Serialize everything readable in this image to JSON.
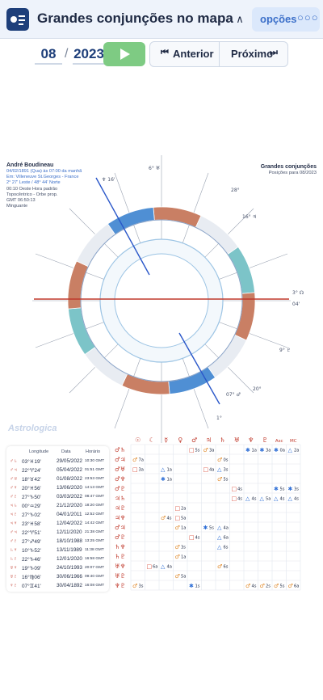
{
  "header": {
    "title": "Grandes conjunções no mapa",
    "options_label": "opções",
    "options_dots": "○○○",
    "collapse_glyph": "∧"
  },
  "date_nav": {
    "month": "08",
    "separator": "/",
    "year": "2023",
    "prev_label": "Anterior",
    "next_label": "Próximo"
  },
  "chart": {
    "left_info": {
      "name": "André Boudineau",
      "line1": "04/02/1891 (Qua) às 07:00 da manhã",
      "line2": "Em: Villeneuve St.Georges - France",
      "line3": "2° 27' Leste / 48° 44' Norte",
      "line4": "00:10 Oeste Hora padrão",
      "line5": "Topocêntrico - Orbe prop.",
      "line6": "GMT 06:50:13",
      "line7": "Minguante"
    },
    "right_info": {
      "name": "Grandes conjunções",
      "line1": "Posições para 08/2023"
    },
    "watermark": "Astrologica",
    "outer_labels": [
      {
        "text": "16'",
        "glyph": "♆"
      },
      {
        "text": "6°",
        "glyph": "♅"
      },
      {
        "text": "28°",
        "glyph": ""
      },
      {
        "text": "16°",
        "glyph": "♃"
      },
      {
        "text": "3°",
        "glyph": "☊"
      },
      {
        "text": "04'",
        "glyph": ""
      },
      {
        "text": "9°",
        "glyph": "♇"
      },
      {
        "text": "20°",
        "glyph": ""
      },
      {
        "text": "07°",
        "glyph": "♂"
      },
      {
        "text": "1°",
        "glyph": ""
      }
    ]
  },
  "left_table": {
    "headers": [
      "Longitude",
      "Data",
      "Horário"
    ],
    "rows": [
      {
        "pair": "♂♄",
        "lon": "03°♓19'",
        "date": "29/05/2022",
        "time": "10:30 GMT"
      },
      {
        "pair": "♂♃",
        "lon": "22°♈24'",
        "date": "05/04/2022",
        "time": "01:51 GMT"
      },
      {
        "pair": "♂♅",
        "lon": "18°♉42'",
        "date": "01/08/2022",
        "time": "23:53 GMT"
      },
      {
        "pair": "♂♆",
        "lon": "20°♓56'",
        "date": "13/06/2020",
        "time": "14:13 GMT"
      },
      {
        "pair": "♂♇",
        "lon": "27°♑50'",
        "date": "03/03/2022",
        "time": "08:47 GMT"
      },
      {
        "pair": "♃♄",
        "lon": "00°♒29'",
        "date": "21/12/2020",
        "time": "18:20 GMT"
      },
      {
        "pair": "♃♇",
        "lon": "27°♑02'",
        "date": "04/01/2011",
        "time": "12:52 GMT"
      },
      {
        "pair": "♃♆",
        "lon": "23°♓58'",
        "date": "12/04/2022",
        "time": "14:42 GMT"
      },
      {
        "pair": "♂♃",
        "lon": "22°♈51'",
        "date": "12/11/2020",
        "time": "21:38 GMT"
      },
      {
        "pair": "♂♇",
        "lon": "27°♐49'",
        "date": "18/10/1988",
        "time": "13:25 GMT"
      },
      {
        "pair": "♄♆",
        "lon": "10°♑52'",
        "date": "13/11/1989",
        "time": "11:38 GMT"
      },
      {
        "pair": "♄♇",
        "lon": "22°♑46'",
        "date": "12/01/2020",
        "time": "16:58 GMT"
      },
      {
        "pair": "♅♆",
        "lon": "19°♑09'",
        "date": "24/10/1993",
        "time": "20:07 GMT"
      },
      {
        "pair": "♅♇",
        "lon": "16°♍06'",
        "date": "30/06/1966",
        "time": "09:40 GMT"
      },
      {
        "pair": "♆♇",
        "lon": "07°♊41'",
        "date": "30/04/1892",
        "time": "16:08 GMT"
      }
    ]
  },
  "aspect_grid": {
    "col_glyphs": [
      "☉",
      "☾",
      "☿",
      "♀",
      "♂",
      "♃",
      "♄",
      "♅",
      "♆",
      "♇",
      "Asc",
      "MC"
    ],
    "row_glyphs": [
      "♂♄",
      "♂♃",
      "♂♅",
      "♂♆",
      "♂♇",
      "♃♄",
      "♃♇",
      "♃♆",
      "♂♃",
      "♂♇",
      "♄♆",
      "♄♇",
      "♅♆",
      "♅♇",
      "♆♇"
    ],
    "cells": [
      {
        "r": 0,
        "c": 4,
        "sym": "□",
        "val": "5s",
        "color": "#d84b3a"
      },
      {
        "r": 0,
        "c": 5,
        "sym": "♂",
        "val": "3a",
        "color": "#e08a2c"
      },
      {
        "r": 0,
        "c": 8,
        "sym": "✱",
        "val": "1a",
        "color": "#2f6fd6"
      },
      {
        "r": 0,
        "c": 9,
        "sym": "✱",
        "val": "3a",
        "color": "#2f6fd6"
      },
      {
        "r": 0,
        "c": 10,
        "sym": "✱",
        "val": "0a",
        "color": "#2f6fd6"
      },
      {
        "r": 0,
        "c": 11,
        "sym": "△",
        "val": "2a",
        "color": "#2f6fd6"
      },
      {
        "r": 1,
        "c": 0,
        "sym": "♂",
        "val": "7a",
        "color": "#e08a2c"
      },
      {
        "r": 1,
        "c": 6,
        "sym": "♂",
        "val": "0s",
        "color": "#e08a2c"
      },
      {
        "r": 2,
        "c": 0,
        "sym": "□",
        "val": "3a",
        "color": "#d84b3a"
      },
      {
        "r": 2,
        "c": 2,
        "sym": "△",
        "val": "1a",
        "color": "#2f6fd6"
      },
      {
        "r": 2,
        "c": 5,
        "sym": "□",
        "val": "4a",
        "color": "#d84b3a"
      },
      {
        "r": 2,
        "c": 6,
        "sym": "△",
        "val": "3s",
        "color": "#2f6fd6"
      },
      {
        "r": 3,
        "c": 2,
        "sym": "✱",
        "val": "1a",
        "color": "#2f6fd6"
      },
      {
        "r": 3,
        "c": 6,
        "sym": "♂",
        "val": "5s",
        "color": "#e08a2c"
      },
      {
        "r": 4,
        "c": 7,
        "sym": "□",
        "val": "4s",
        "color": "#d84b3a"
      },
      {
        "r": 4,
        "c": 10,
        "sym": "✱",
        "val": "5s",
        "color": "#2f6fd6"
      },
      {
        "r": 4,
        "c": 11,
        "sym": "✱",
        "val": "3s",
        "color": "#2f6fd6"
      },
      {
        "r": 5,
        "c": 7,
        "sym": "□",
        "val": "4s",
        "color": "#d84b3a"
      },
      {
        "r": 5,
        "c": 8,
        "sym": "△",
        "val": "4s",
        "color": "#2f6fd6"
      },
      {
        "r": 5,
        "c": 9,
        "sym": "△",
        "val": "5a",
        "color": "#2f6fd6"
      },
      {
        "r": 5,
        "c": 10,
        "sym": "△",
        "val": "4s",
        "color": "#2f6fd6"
      },
      {
        "r": 5,
        "c": 11,
        "sym": "△",
        "val": "4s",
        "color": "#2f6fd6"
      },
      {
        "r": 6,
        "c": 3,
        "sym": "□",
        "val": "2a",
        "color": "#d84b3a"
      },
      {
        "r": 7,
        "c": 2,
        "sym": "♂",
        "val": "4s",
        "color": "#e08a2c"
      },
      {
        "r": 7,
        "c": 3,
        "sym": "□",
        "val": "5a",
        "color": "#d84b3a"
      },
      {
        "r": 8,
        "c": 3,
        "sym": "♂",
        "val": "1a",
        "color": "#e08a2c"
      },
      {
        "r": 8,
        "c": 5,
        "sym": "✱",
        "val": "5s",
        "color": "#2f6fd6"
      },
      {
        "r": 8,
        "c": 6,
        "sym": "△",
        "val": "4a",
        "color": "#2f6fd6"
      },
      {
        "r": 9,
        "c": 4,
        "sym": "□",
        "val": "4s",
        "color": "#d84b3a"
      },
      {
        "r": 9,
        "c": 6,
        "sym": "△",
        "val": "6a",
        "color": "#2f6fd6"
      },
      {
        "r": 10,
        "c": 3,
        "sym": "♂",
        "val": "3s",
        "color": "#e08a2c"
      },
      {
        "r": 10,
        "c": 6,
        "sym": "△",
        "val": "6s",
        "color": "#2f6fd6"
      },
      {
        "r": 11,
        "c": 3,
        "sym": "♂",
        "val": "1a",
        "color": "#e08a2c"
      },
      {
        "r": 12,
        "c": 1,
        "sym": "□",
        "val": "6a",
        "color": "#d84b3a"
      },
      {
        "r": 12,
        "c": 2,
        "sym": "△",
        "val": "4a",
        "color": "#2f6fd6"
      },
      {
        "r": 12,
        "c": 6,
        "sym": "♂",
        "val": "6s",
        "color": "#e08a2c"
      },
      {
        "r": 13,
        "c": 3,
        "sym": "♂",
        "val": "5a",
        "color": "#e08a2c"
      },
      {
        "r": 14,
        "c": 0,
        "sym": "♂",
        "val": "3s",
        "color": "#e08a2c"
      },
      {
        "r": 14,
        "c": 4,
        "sym": "✱",
        "val": "1s",
        "color": "#2f6fd6"
      },
      {
        "r": 14,
        "c": 8,
        "sym": "♂",
        "val": "4s",
        "color": "#e08a2c"
      },
      {
        "r": 14,
        "c": 9,
        "sym": "♂",
        "val": "2s",
        "color": "#e08a2c"
      },
      {
        "r": 14,
        "c": 10,
        "sym": "♂",
        "val": "5s",
        "color": "#e08a2c"
      },
      {
        "r": 14,
        "c": 11,
        "sym": "♂",
        "val": "6a",
        "color": "#e08a2c"
      }
    ]
  }
}
